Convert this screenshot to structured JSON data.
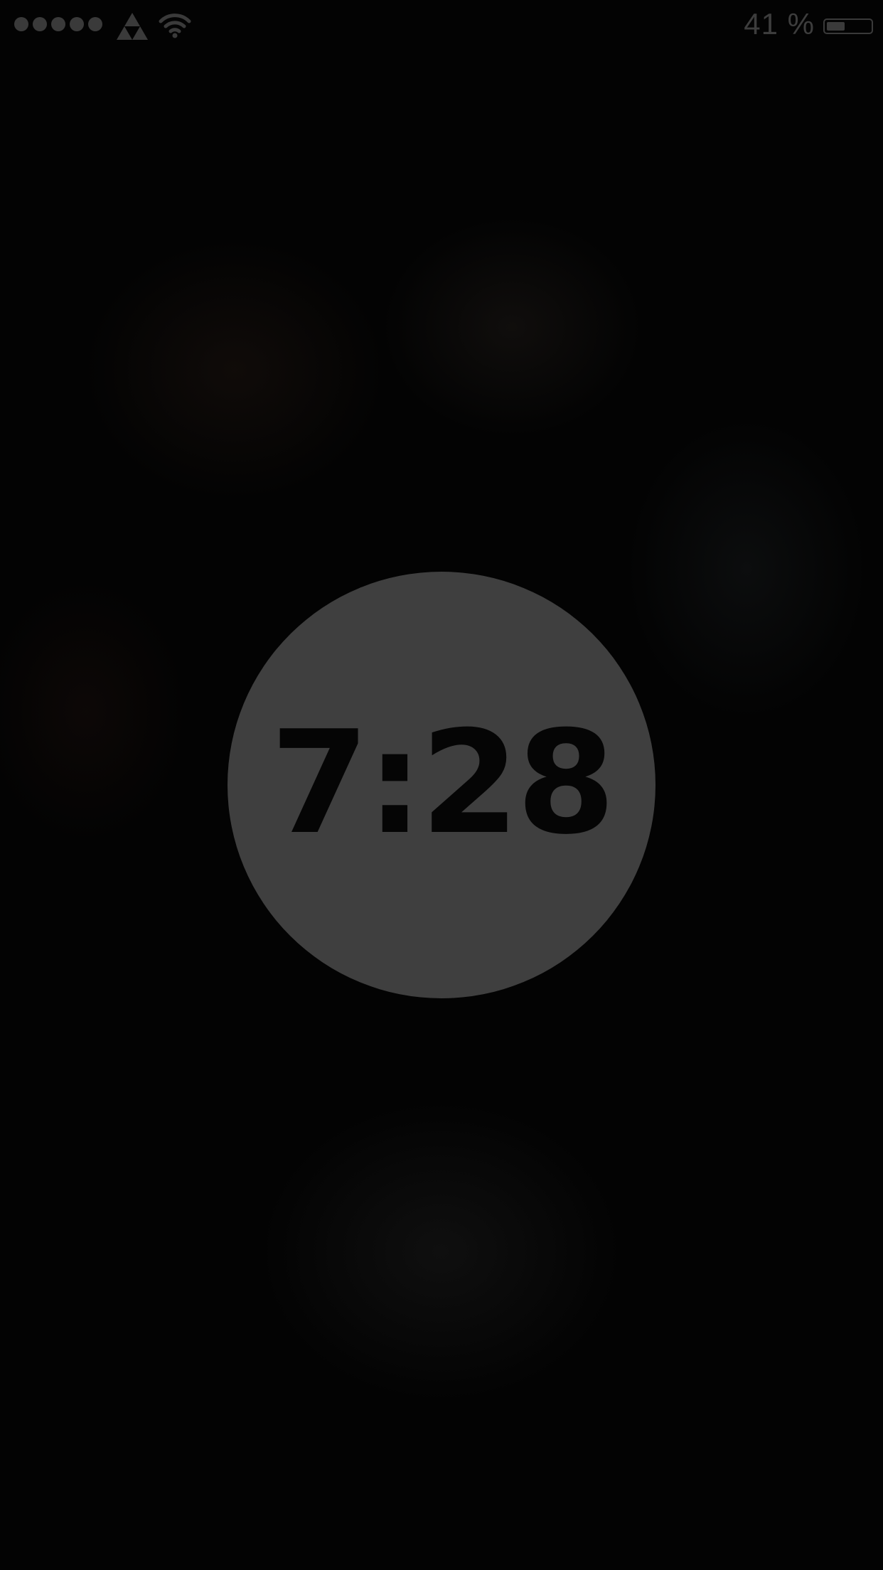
{
  "status_bar": {
    "signal_bars": 5,
    "carrier_icon": "triforce-icon",
    "wifi_icon": "wifi-icon",
    "battery_percent": "41 %",
    "battery_level": 0.41,
    "color": "#3a3a3a"
  },
  "clock": {
    "time": "7:28",
    "circle_color": "#3f3f3f",
    "text_color": "#050505"
  },
  "background_color": "#030303"
}
